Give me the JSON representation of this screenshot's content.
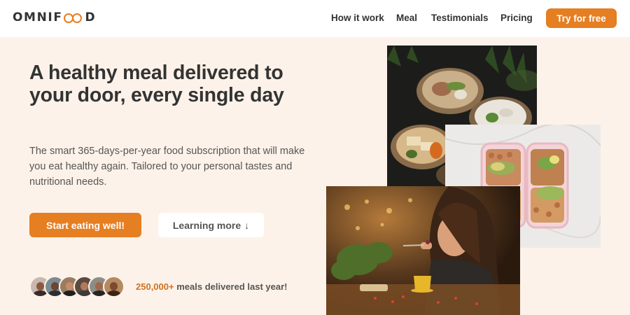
{
  "nav": {
    "logo_text_left": "OMNIF",
    "logo_text_right": "D",
    "links": [
      "How it work",
      "Meal",
      "Testimonials",
      "Pricing"
    ],
    "cta_label": "Try for free"
  },
  "hero": {
    "title": "A healthy meal delivered to your door, every single day",
    "description": "The smart 365-days-per-year food subscription that will make you eat healthy again. Tailored to your personal tastes and nutritional needs.",
    "primary_button": "Start eating well!",
    "secondary_button": "Learning more",
    "secondary_arrow": "↓"
  },
  "delivered": {
    "count": "250,000+",
    "text": "meals delivered last year!"
  },
  "colors": {
    "brand": "#e67e22",
    "background": "#fdf2e9",
    "text": "#333333"
  }
}
